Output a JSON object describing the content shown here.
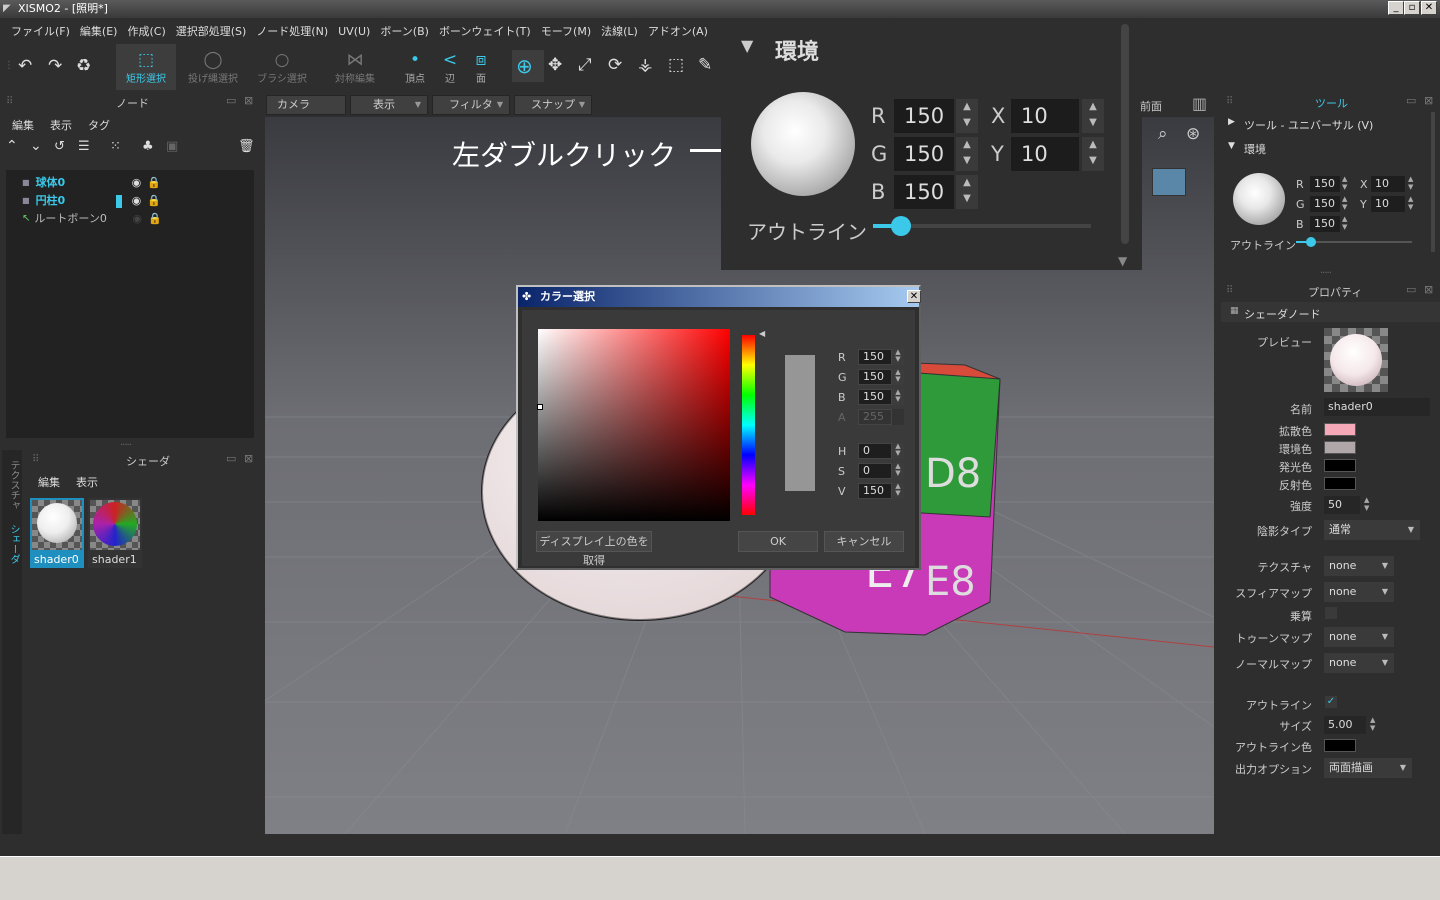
{
  "window": {
    "title": "XISMO2 - [照明*]",
    "controls": [
      "_",
      "▫",
      "✕"
    ]
  },
  "menu": [
    "ファイル(F)",
    "編集(E)",
    "作成(C)",
    "選択部処理(S)",
    "ノード処理(N)",
    "UV(U)",
    "ボーン(B)",
    "ボーンウェイト(T)",
    "モーフ(M)",
    "法線(L)",
    "アドオン(A)"
  ],
  "toolbar": {
    "rect_select": "矩形選択",
    "lasso_select": "投げ縄選択",
    "brush_select": "ブラシ選択",
    "sym_edit": "対称編集",
    "vertex": "頂点",
    "edge": "辺",
    "face": "面"
  },
  "node_panel": {
    "title": "ノード",
    "menu": [
      "編集",
      "表示",
      "タグ"
    ],
    "items": [
      {
        "name": "球体0",
        "color": "#3cc8e8"
      },
      {
        "name": "円柱0",
        "color": "#3cc8e8"
      },
      {
        "name": "ルートボーン0",
        "color": "#bbbbbb"
      }
    ]
  },
  "shader_panel": {
    "title": "シェーダ",
    "menu": [
      "編集",
      "表示"
    ],
    "side_tabs": [
      "テクスチャ",
      "シェーダ"
    ],
    "items": [
      {
        "name": "shader0",
        "selected": true
      },
      {
        "name": "shader1",
        "selected": false
      }
    ]
  },
  "view_tabs": {
    "camera": "カメラ",
    "display": "表示",
    "filter": "フィルタ",
    "snap": "スナップ",
    "front": "前面"
  },
  "cylinder_labels": [
    "7",
    "D8",
    "7",
    "E8",
    "E7",
    "D"
  ],
  "annotation": "左ダブルクリック",
  "zoom_panel": {
    "title": "環境",
    "r": "150",
    "g": "150",
    "b": "150",
    "x": "10",
    "y": "10",
    "outline": "アウトライン",
    "outline_level": 0.13,
    "r_label": "R",
    "g_label": "G",
    "b_label": "B",
    "x_label": "X",
    "y_label": "Y"
  },
  "color_dialog": {
    "title": "カラー選択",
    "r": "150",
    "g": "150",
    "b": "150",
    "a": "255",
    "h": "0",
    "s": "0",
    "v": "150",
    "r_label": "R",
    "g_label": "G",
    "b_label": "B",
    "a_label": "A",
    "h_label": "H",
    "s_label": "S",
    "v_label": "V",
    "pick_label": "ディスプレイ上の色を取得",
    "ok": "OK",
    "cancel": "キャンセル"
  },
  "tool_panel": {
    "title": "ツール",
    "universal": "ツール - ユニバーサル (V)",
    "env": "環境",
    "r": "150",
    "g": "150",
    "b": "150",
    "x": "10",
    "y": "10",
    "outline": "アウトライン",
    "r_label": "R",
    "g_label": "G",
    "b_label": "B",
    "x_label": "X",
    "y_label": "Y"
  },
  "property_panel": {
    "title": "プロパティ",
    "section": "シェーダノード",
    "preview": "プレビュー",
    "name_label": "名前",
    "name": "shader0",
    "diffuse": "拡散色",
    "ambient": "環境色",
    "emissive": "発光色",
    "specular": "反射色",
    "strength_label": "強度",
    "strength": "50",
    "shade_type_label": "陰影タイプ",
    "shade_type": "通常",
    "texture_label": "テクスチャ",
    "texture": "none",
    "sphere_label": "スフィアマップ",
    "sphere": "none",
    "multiply_label": "乗算",
    "toon_label": "トゥーンマップ",
    "toon": "none",
    "normal_label": "ノーマルマップ",
    "normal": "none",
    "outline_label": "アウトライン",
    "size_label": "サイズ",
    "size": "5.00",
    "outline_color_label": "アウトライン色",
    "output_label": "出力オプション",
    "output": "両面描画"
  },
  "colors": {
    "accent": "#3cc8e8",
    "diffuse": "#f5a8b8",
    "ambient": "#b0a8a8",
    "emissive": "#000000",
    "specular": "#000000",
    "outline_color": "#000000"
  }
}
